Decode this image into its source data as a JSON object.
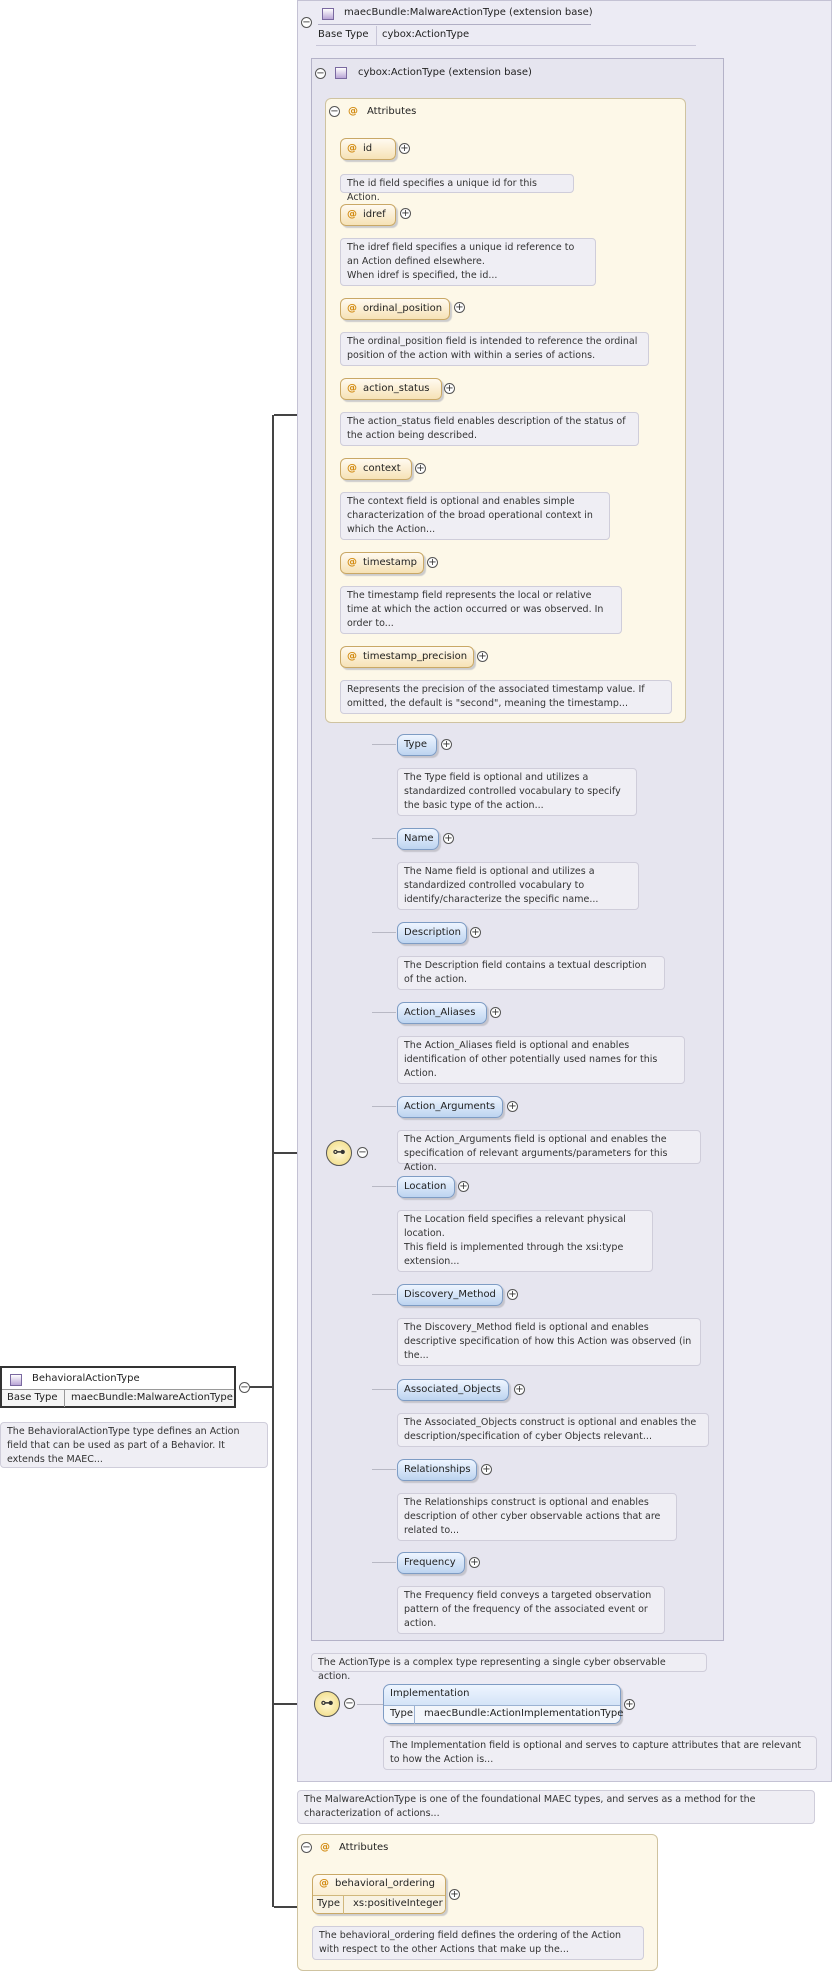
{
  "root": {
    "name": "BehavioralActionType",
    "base_type_label": "Base Type",
    "base_type_value": "maecBundle:MalwareActionType",
    "doc": "The BehavioralActionType type defines an Action field that can be used as part of a Behavior. It extends the MAEC..."
  },
  "malware_ext": {
    "title": "maecBundle:MalwareActionType (extension base)",
    "base_type_label": "Base Type",
    "base_type_value": "cybox:ActionType",
    "doc": "The MalwareActionType is one of the foundational MAEC types, and serves as a method for the characterization of actions..."
  },
  "cybox_ext": {
    "title": "cybox:ActionType (extension base)",
    "doc": "The ActionType is a complex type representing a single cyber observable action."
  },
  "cybox_attributes": {
    "title": "Attributes",
    "items": [
      {
        "name": "id",
        "doc": "The id field specifies a unique id for this Action."
      },
      {
        "name": "idref",
        "doc": "The idref field specifies a unique id reference to an Action defined elsewhere.\nWhen idref is specified, the id..."
      },
      {
        "name": "ordinal_position",
        "doc": "The ordinal_position field is intended to reference the ordinal position of the action with within a series of actions."
      },
      {
        "name": "action_status",
        "doc": "The action_status field enables description of the status of the action being described."
      },
      {
        "name": "context",
        "doc": "The context field is optional and enables simple characterization of the broad operational context in which the Action..."
      },
      {
        "name": "timestamp",
        "doc": "The timestamp field represents the local or relative time at which the action occurred or was observed. In order to..."
      },
      {
        "name": "timestamp_precision",
        "doc": "Represents the precision of the associated timestamp value. If omitted, the default is \"second\", meaning the timestamp..."
      }
    ]
  },
  "sequence_elements": [
    {
      "name": "Type",
      "doc": "The Type field is optional and utilizes a standardized controlled vocabulary to specify the basic type of the action..."
    },
    {
      "name": "Name",
      "doc": "The Name field is optional and utilizes a standardized controlled vocabulary to identify/characterize the specific name..."
    },
    {
      "name": "Description",
      "doc": "The Description field contains a textual description of the action."
    },
    {
      "name": "Action_Aliases",
      "doc": "The Action_Aliases field is optional and enables identification of other potentially used names for this Action."
    },
    {
      "name": "Action_Arguments",
      "doc": "The Action_Arguments field is optional and enables the specification of relevant arguments/parameters for this Action."
    },
    {
      "name": "Location",
      "doc": "The Location field specifies a relevant physical location.\nThis field is implemented through the xsi:type extension..."
    },
    {
      "name": "Discovery_Method",
      "doc": "The Discovery_Method field is optional and enables descriptive specification of how this Action was observed (in the..."
    },
    {
      "name": "Associated_Objects",
      "doc": "The Associated_Objects construct is optional and enables the description/specification of cyber Objects relevant..."
    },
    {
      "name": "Relationships",
      "doc": "The Relationships construct is optional and enables description of other cyber observable actions that are related to..."
    },
    {
      "name": "Frequency",
      "doc": "The Frequency field conveys a targeted observation pattern of the frequency of the associated event or action."
    }
  ],
  "implementation": {
    "name": "Implementation",
    "type_label": "Type",
    "type_value": "maecBundle:ActionImplementationType",
    "doc": "The Implementation field is optional and serves to capture attributes that are relevant to how the Action is..."
  },
  "root_attributes": {
    "title": "Attributes",
    "item": {
      "name": "behavioral_ordering",
      "type_label": "Type",
      "type_value": "xs:positiveInteger",
      "doc": "The behavioral_ordering field defines the ordering of the Action with respect to the other Actions that make up the..."
    }
  },
  "symbols": {
    "plus": "+",
    "minus": "−",
    "at": "@",
    "sequence": "⊶"
  }
}
